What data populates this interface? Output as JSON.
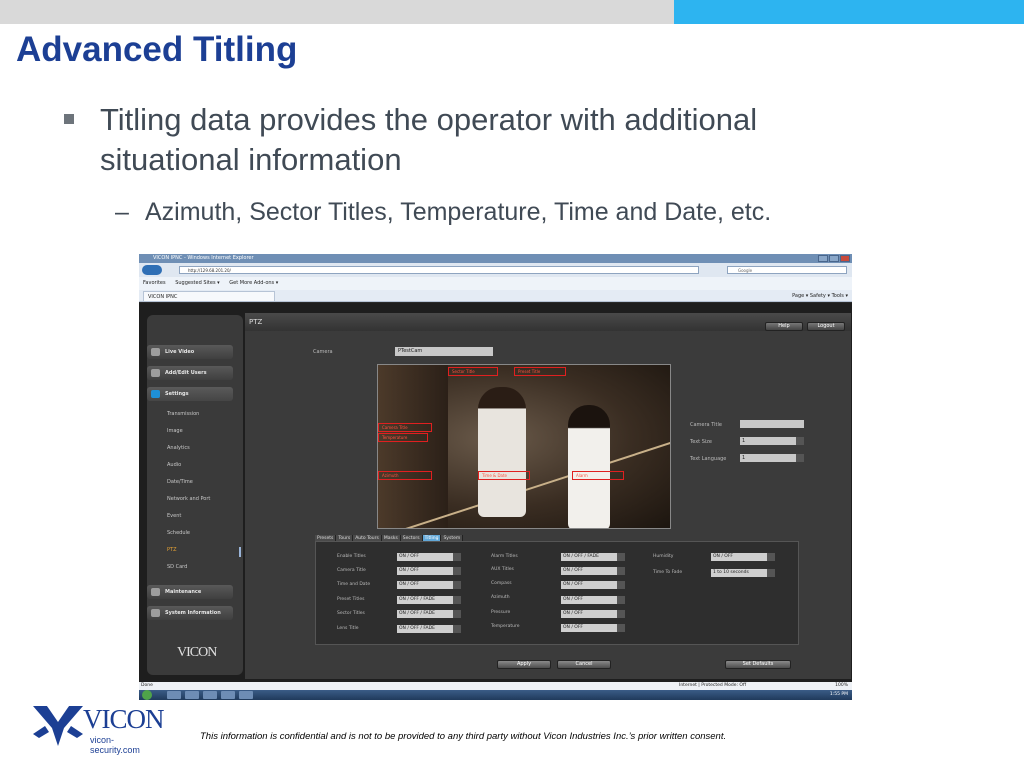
{
  "slide": {
    "title": "Advanced Titling",
    "bullet1": "Titling data provides the operator with additional situational information",
    "bullet2_dash": "–",
    "bullet2": "Azimuth, Sector Titles, Temperature, Time and Date, etc.",
    "footer": "This information is confidential and is not to be provided to any third party without Vicon Industries Inc.’s  prior written consent.",
    "logo_text": "VICON",
    "logo_url": "vicon-security.com",
    "colors": {
      "title": "#1c3f94",
      "top_bar_gray": "#d9d9d9",
      "top_bar_blue": "#2db4f0",
      "body_text": "#404a55"
    }
  },
  "browser": {
    "window_title": "VICON IPNC - Windows Internet Explorer",
    "address": "http://129.68.201.20/",
    "search_placeholder": "Google",
    "favorites": {
      "favorites_label": "Favorites",
      "suggested_sites": "Suggested Sites ▾",
      "get_more": "Get More Add-ons ▾"
    },
    "tab_label": "VICON IPNC",
    "tools": "Page ▾  Safety ▾  Tools ▾",
    "status_left": "Done",
    "status_zone": "Internet | Protected Mode: Off",
    "status_zoom": "100%",
    "clock": "1:55 PM"
  },
  "app": {
    "page_header": "PTZ",
    "help_button": "Help",
    "logout_button": "Logout",
    "sidebar": {
      "live_video": "Live Video",
      "add_edit_users": "Add/Edit Users",
      "settings": "Settings",
      "sub_items": [
        "Transmission",
        "Image",
        "Analytics",
        "Audio",
        "Date/Time",
        "Network and Port",
        "Event",
        "Schedule",
        "PTZ",
        "SD Card"
      ],
      "maintenance": "Maintenance",
      "system_information": "System Information",
      "logo": "VICON"
    },
    "camera_label": "Camera",
    "camera_value": "PTestCam",
    "video_titles": {
      "top_left": "Sector Title",
      "top_right": "Preset Title",
      "mid_left_1": "Camera Title",
      "mid_left_2": "Temperature",
      "bottom_left": "Azimuth",
      "bottom_mid": "Time & Date",
      "bottom_right": "Alarm"
    },
    "side_settings": {
      "camera_title_label": "Camera Title",
      "camera_title_value": "",
      "text_size_label": "Text Size",
      "text_size_value": "1",
      "text_language_label": "Text Language",
      "text_language_value": "1"
    },
    "tabs": [
      "Presets",
      "Tours",
      "Auto Tours",
      "Masks",
      "Sectors",
      "Titling",
      "System"
    ],
    "active_tab": "Titling",
    "titling": {
      "col1": [
        {
          "label": "Enable Titles",
          "value": "ON / OFF"
        },
        {
          "label": "Camera Title",
          "value": "ON / OFF"
        },
        {
          "label": "Time and Date",
          "value": "ON / OFF"
        },
        {
          "label": "Preset Titles",
          "value": "ON / OFF / FADE"
        },
        {
          "label": "Sector Titles",
          "value": "ON / OFF / FADE"
        },
        {
          "label": "Lens Title",
          "value": "ON / OFF / FADE"
        }
      ],
      "col2": [
        {
          "label": "Alarm Titles",
          "value": "ON / OFF / FADE"
        },
        {
          "label": "AUX Titles",
          "value": "ON / OFF"
        },
        {
          "label": "Compass",
          "value": "ON / OFF"
        },
        {
          "label": "Azimuth",
          "value": "ON / OFF"
        },
        {
          "label": "Pressure",
          "value": "ON / OFF"
        },
        {
          "label": "Temperature",
          "value": "ON / OFF"
        }
      ],
      "col3": [
        {
          "label": "Humidity",
          "value": "ON / OFF"
        },
        {
          "label": "Time To Fade",
          "value": "1 to 10 seconds"
        }
      ]
    },
    "apply_button": "Apply",
    "cancel_button": "Cancel",
    "set_defaults_button": "Set Defaults"
  }
}
